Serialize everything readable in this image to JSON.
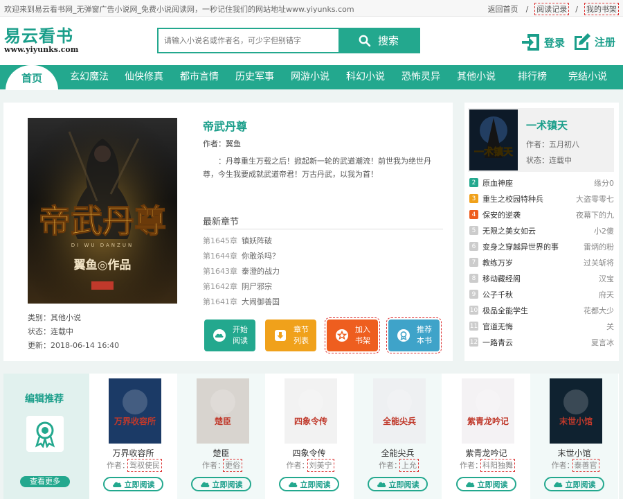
{
  "topbar": {
    "welcome": "欢迎来到易云看书网_无弹窗广告小说网_免费小说阅读网，一秒记住我们的网站地址www.yiyunks.com",
    "home": "返回首页",
    "history": "阅读记录",
    "shelf": "我的书架"
  },
  "logo": {
    "title": "易云看书",
    "url": "www.yiyunks.com"
  },
  "search": {
    "placeholder": "请输入小说名或作者名，可少字但别错字",
    "button": "搜索"
  },
  "auth": {
    "login": "登录",
    "register": "注册"
  },
  "nav": [
    "首页",
    "玄幻魔法",
    "仙侠修真",
    "都市言情",
    "历史军事",
    "网游小说",
    "科幻小说",
    "恐怖灵异",
    "其他小说",
    "排行榜",
    "完结小说"
  ],
  "book": {
    "title": "帝武丹尊",
    "author_label": "作者：",
    "author": "翼鱼",
    "description": "：丹尊重生万载之后！掀起新一轮的武道潮流！前世我为绝世丹尊，今生我要成就武道帝君！万古丹武，以我为首！",
    "cover_title": "帝武丹尊",
    "cover_pinyin": "DI WU DANZUN",
    "cover_byline": "翼鱼◎作品",
    "category": "类别：其他小说",
    "status": "状态：连载中",
    "updated": "更新：2018-06-14 16:40",
    "latest_heading": "最新章节",
    "chapters": [
      {
        "num": "第1645章",
        "name": "镇妖阵破"
      },
      {
        "num": "第1644章",
        "name": "你敢杀吗？"
      },
      {
        "num": "第1643章",
        "name": "泰澄的战力"
      },
      {
        "num": "第1642章",
        "name": "阴尸邪宗"
      },
      {
        "num": "第1641章",
        "name": "大闹御善国"
      }
    ],
    "actions": [
      {
        "top": "开始",
        "bottom": "阅读",
        "color": "#23a88e"
      },
      {
        "top": "章节",
        "bottom": "列表",
        "color": "#f0a11b"
      },
      {
        "top": "加入",
        "bottom": "书架",
        "color": "#ee5e1f"
      },
      {
        "top": "推荐",
        "bottom": "本书",
        "color": "#3fa3c9"
      }
    ]
  },
  "featured": {
    "title": "一术镇天",
    "author": "作者：五月初八",
    "status": "状态：连载中",
    "cover_text": "一术镇天"
  },
  "ranking": [
    {
      "n": "2",
      "title": "原血神座",
      "author": "缘分0",
      "color": "#23a88e"
    },
    {
      "n": "3",
      "title": "重生之校园特种兵",
      "author": "大盗零零七",
      "color": "#f0a11b"
    },
    {
      "n": "4",
      "title": "保安的逆袭",
      "author": "夜幕下的九",
      "color": "#ee5e1f"
    },
    {
      "n": "5",
      "title": "无限之美女如云",
      "author": "小2傻",
      "color": "#cccccc"
    },
    {
      "n": "6",
      "title": "变身之穿越异世界的事",
      "author": "雷炳的粉",
      "color": "#cccccc"
    },
    {
      "n": "7",
      "title": "教练万岁",
      "author": "过关斩将",
      "color": "#cccccc"
    },
    {
      "n": "8",
      "title": "移动藏经阁",
      "author": "汉宝",
      "color": "#cccccc"
    },
    {
      "n": "9",
      "title": "公子千秋",
      "author": "府天",
      "color": "#cccccc"
    },
    {
      "n": "10",
      "title": "极品全能学生",
      "author": "花都大少",
      "color": "#cccccc"
    },
    {
      "n": "11",
      "title": "官道无悔",
      "author": "关",
      "color": "#cccccc"
    },
    {
      "n": "12",
      "title": "一路青云",
      "author": "夏言冰",
      "color": "#cccccc"
    }
  ],
  "recommend": {
    "heading": "编辑推荐",
    "more": "查看更多",
    "author_label": "作者：",
    "read_label": "立即阅读",
    "books": [
      {
        "title": "万界收容所",
        "author": "驾驭使民",
        "cover": "万界收容所",
        "bg": "#1b3a66"
      },
      {
        "title": "楚臣",
        "author": "更俗",
        "cover": "楚臣",
        "bg": "#d8d4cf"
      },
      {
        "title": "四象令传",
        "author": "刘美宁",
        "cover": "四象令传",
        "bg": "#f2f2f2"
      },
      {
        "title": "全能尖兵",
        "author": "上允",
        "cover": "全能尖兵",
        "bg": "#eef0f2"
      },
      {
        "title": "紫青龙吟记",
        "author": "科阳独舞",
        "cover": "紫青龙吟记",
        "bg": "#f4f2f4"
      },
      {
        "title": "末世小馆",
        "author": "泰善官",
        "cover": "末世小馆",
        "bg": "#0f2230"
      }
    ]
  }
}
